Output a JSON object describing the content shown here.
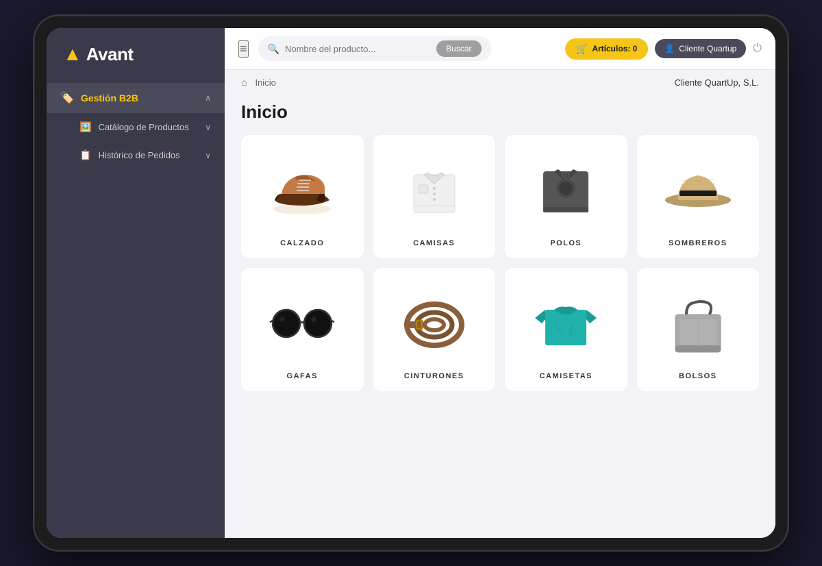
{
  "app": {
    "name": "Avant",
    "logo_symbol": "▲"
  },
  "sidebar": {
    "active_item": "Gestión B2B",
    "items": [
      {
        "id": "gestion-b2b",
        "label": "Gestión B2B",
        "icon": "🏷️",
        "active": true,
        "expanded": true,
        "chevron": "∧"
      },
      {
        "id": "catalogo",
        "label": "Catálogo de Productos",
        "icon": "🖼️",
        "active": false,
        "chevron": "∨"
      },
      {
        "id": "historico",
        "label": "Histórico de Pedidos",
        "icon": "📋",
        "active": false,
        "chevron": "∨"
      }
    ]
  },
  "topbar": {
    "menu_icon": "≡",
    "search_placeholder": "Nombre del producto...",
    "search_button_label": "Buscar",
    "cart_label": "Artículos: 0",
    "client_label": "Cliente Quartup",
    "power_icon": "⏻"
  },
  "breadcrumb": {
    "home_icon": "⌂",
    "items": [
      "Inicio"
    ],
    "client_name": "Cliente QuartUp, S.L."
  },
  "page": {
    "title": "Inicio",
    "categories": [
      {
        "id": "calzado",
        "label": "CALZADO",
        "image_type": "shoes"
      },
      {
        "id": "camisas",
        "label": "CAMISAS",
        "image_type": "shirt"
      },
      {
        "id": "polos",
        "label": "POLOS",
        "image_type": "polo"
      },
      {
        "id": "sombreros",
        "label": "SOMBREROS",
        "image_type": "hat"
      },
      {
        "id": "gafas",
        "label": "GAFAS",
        "image_type": "glasses"
      },
      {
        "id": "cinturones",
        "label": "CINTURONES",
        "image_type": "belt"
      },
      {
        "id": "camisetas",
        "label": "CAMISETAS",
        "image_type": "tshirt"
      },
      {
        "id": "bolsos",
        "label": "BOLSOS",
        "image_type": "bag"
      }
    ]
  },
  "colors": {
    "accent": "#f5c518",
    "sidebar_bg": "#3a3a4a",
    "active_nav_text": "#f5c518"
  }
}
